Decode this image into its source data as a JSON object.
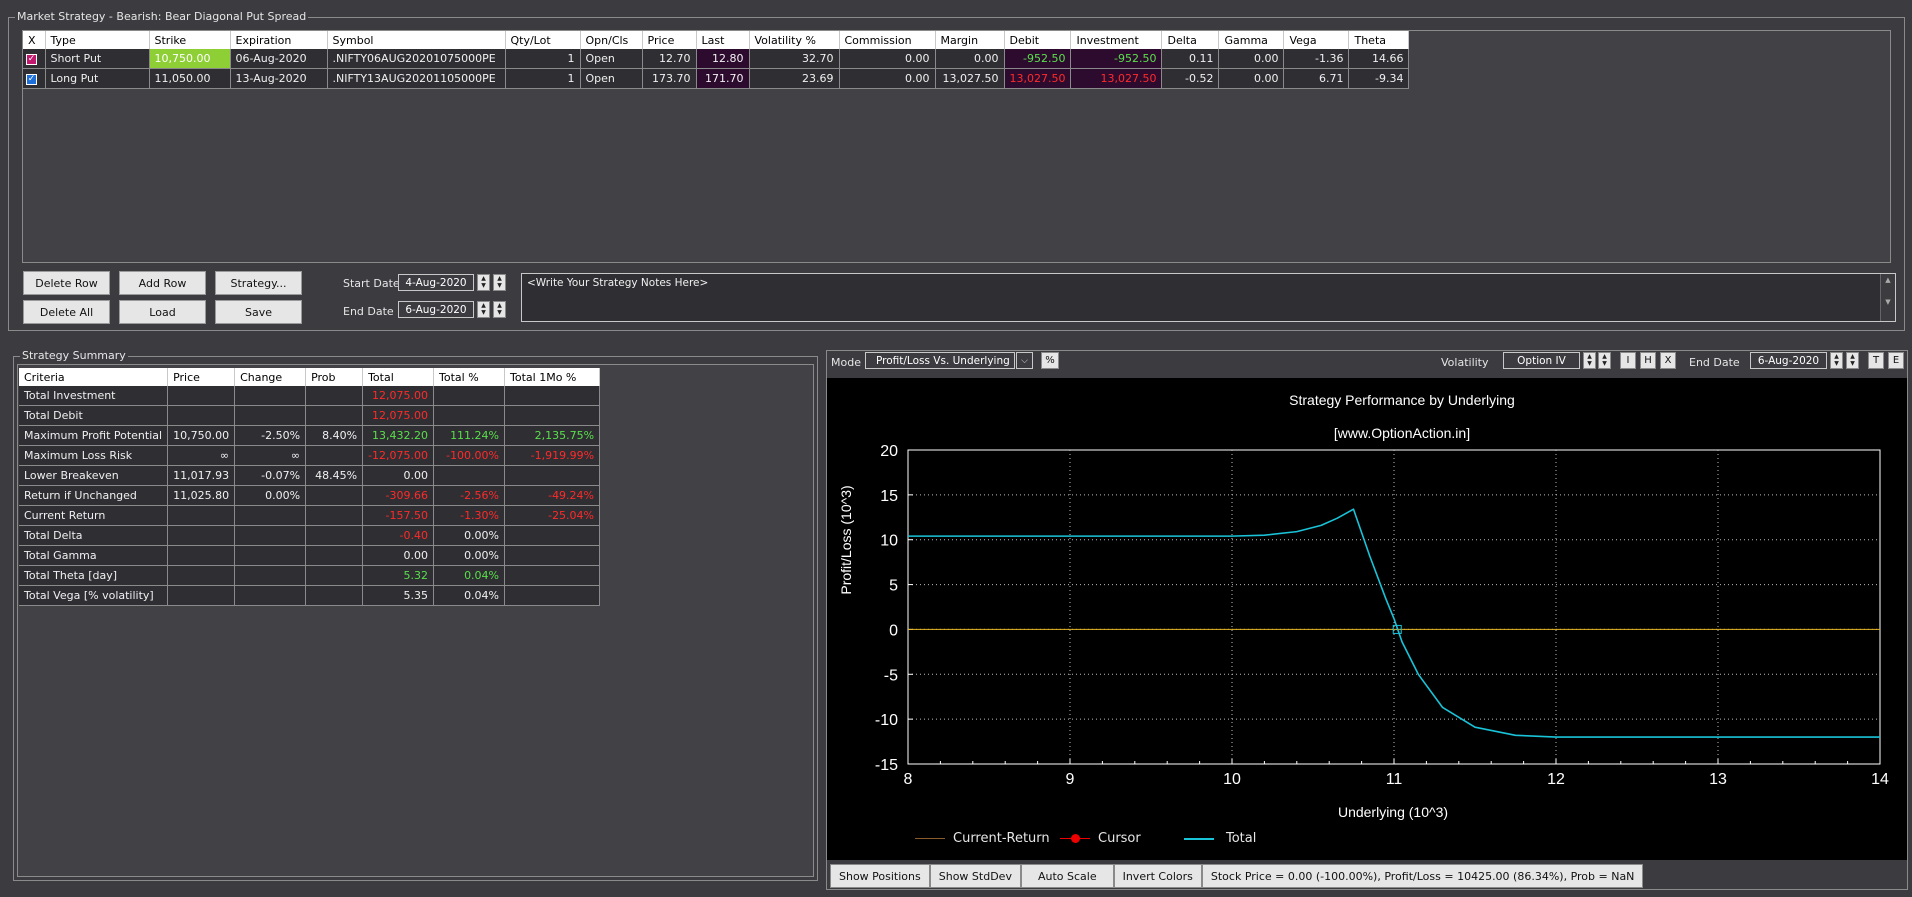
{
  "strategy_group": {
    "title": "Market Strategy - Bearish: Bear Diagonal Put Spread"
  },
  "legs_table": {
    "headers": [
      "X",
      "Type",
      "Strike",
      "Expiration",
      "Symbol",
      "Qty/Lot",
      "Opn/Cls",
      "Price",
      "Last",
      "Volatility %",
      "Commission",
      "Margin",
      "Debit",
      "Investment",
      "Delta",
      "Gamma",
      "Vega",
      "Theta"
    ],
    "rows": [
      [
        "",
        "Short Put",
        "10,750.00",
        "06-Aug-2020",
        ".NIFTY06AUG20201075000PE",
        "1",
        "Open",
        "12.70",
        "12.80",
        "32.70",
        "0.00",
        "0.00",
        "-952.50",
        "-952.50",
        "0.11",
        "0.00",
        "-1.36",
        "14.66"
      ],
      [
        "",
        "Long Put",
        "11,050.00",
        "13-Aug-2020",
        ".NIFTY13AUG20201105000PE",
        "1",
        "Open",
        "173.70",
        "171.70",
        "23.69",
        "0.00",
        "13,027.50",
        "13,027.50",
        "13,027.50",
        "-0.52",
        "0.00",
        "6.71",
        "-9.34"
      ]
    ],
    "checkmark": "✓"
  },
  "buttons": {
    "delete_row": "Delete Row",
    "add_row": "Add Row",
    "strategy": "Strategy...",
    "delete_all": "Delete All",
    "load": "Load",
    "save": "Save"
  },
  "dates": {
    "start_label": "Start Date",
    "start_value": "4-Aug-2020",
    "end_label": "End Date",
    "end_value": "6-Aug-2020"
  },
  "notes": {
    "text": "<Write Your Strategy Notes Here>"
  },
  "summary_group": {
    "title": "Strategy Summary"
  },
  "summary_table": {
    "headers": [
      "Criteria",
      "Price",
      "Change",
      "Prob",
      "Total",
      "Total %",
      "Total 1Mo %"
    ],
    "rows": [
      [
        "Total Investment",
        "",
        "",
        "",
        "12,075.00",
        "",
        ""
      ],
      [
        "Total Debit",
        "",
        "",
        "",
        "12,075.00",
        "",
        ""
      ],
      [
        "Maximum Profit Potential",
        "10,750.00",
        "-2.50%",
        "8.40%",
        "13,432.20",
        "111.24%",
        "2,135.75%"
      ],
      [
        "Maximum Loss Risk",
        "∞",
        "∞",
        "",
        "-12,075.00",
        "-100.00%",
        "-1,919.99%"
      ],
      [
        "Lower Breakeven",
        "11,017.93",
        "-0.07%",
        "48.45%",
        "0.00",
        "",
        ""
      ],
      [
        "Return if Unchanged",
        "11,025.80",
        "0.00%",
        "",
        "-309.66",
        "-2.56%",
        "-49.24%"
      ],
      [
        "Current Return",
        "",
        "",
        "",
        "-157.50",
        "-1.30%",
        "-25.04%"
      ],
      [
        "Total Delta",
        "",
        "",
        "",
        "-0.40",
        "0.00%",
        ""
      ],
      [
        "Total Gamma",
        "",
        "",
        "",
        "0.00",
        "0.00%",
        ""
      ],
      [
        "Total Theta [day]",
        "",
        "",
        "",
        "5.32",
        "0.04%",
        ""
      ],
      [
        "Total Vega [% volatility]",
        "",
        "",
        "",
        "5.35",
        "0.04%",
        ""
      ]
    ]
  },
  "chart_toolbar": {
    "mode_label": "Mode",
    "mode_value": "Profit/Loss Vs. Underlying",
    "percent_btn": "%",
    "volatility_label": "Volatility",
    "volatility_value": "Option IV",
    "btn_i": "I",
    "btn_h": "H",
    "btn_x": "X",
    "end_date_label": "End Date",
    "end_date_value": "6-Aug-2020",
    "btn_t": "T",
    "btn_e": "E"
  },
  "chart_data": {
    "type": "line",
    "title": "Strategy Performance by Underlying",
    "subtitle": "[www.OptionAction.in]",
    "xlabel": "Underlying (10^3)",
    "ylabel": "Profit/Loss (10^3)",
    "xlim": [
      8,
      14
    ],
    "ylim": [
      -15,
      20
    ],
    "xticks": [
      8,
      9,
      10,
      11,
      12,
      13,
      14
    ],
    "yticks": [
      -15,
      -10,
      -5,
      0,
      5,
      10,
      15,
      20
    ],
    "grid": true,
    "series": [
      {
        "name": "Current-Return",
        "color": "#8b5a2b",
        "x": [
          8,
          14
        ],
        "y": [
          0,
          0
        ]
      },
      {
        "name": "Total",
        "color": "#19c3d8",
        "x": [
          8.0,
          9.0,
          10.0,
          10.2,
          10.4,
          10.55,
          10.65,
          10.75,
          10.85,
          10.95,
          11.0,
          11.05,
          11.15,
          11.3,
          11.5,
          11.75,
          12.0,
          13.0,
          14.0
        ],
        "y": [
          10.4,
          10.4,
          10.4,
          10.5,
          10.9,
          11.6,
          12.4,
          13.4,
          8.2,
          3.4,
          1.2,
          -1.4,
          -5.0,
          -8.7,
          -10.9,
          -11.8,
          -12.0,
          -12.0,
          -12.0
        ]
      }
    ],
    "cursor": {
      "name": "Cursor",
      "x": 11.02,
      "y": 0
    }
  },
  "legend": {
    "current": "Current-Return",
    "cursor": "Cursor",
    "total": "Total"
  },
  "status_bar": {
    "show_positions": "Show Positions",
    "show_stddev": "Show StdDev",
    "auto_scale": "Auto Scale",
    "invert_colors": "Invert Colors",
    "info": "Stock Price = 0.00 (-100.00%), Profit/Loss = 10425.00 (86.34%), Prob = NaN"
  }
}
